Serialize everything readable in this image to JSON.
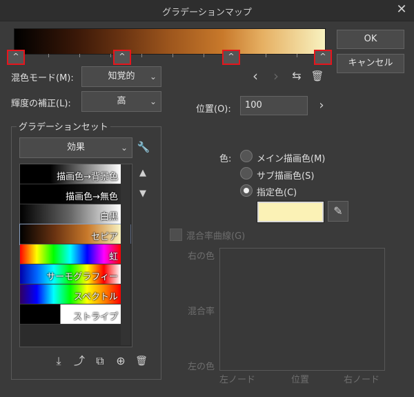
{
  "window": {
    "title": "グラデーションマップ",
    "close_glyph": "✕"
  },
  "buttons": {
    "ok": "OK",
    "cancel": "キャンセル"
  },
  "node_glyph": "^",
  "blend_mode": {
    "label": "混色モード(M):",
    "value": "知覚的"
  },
  "brightness": {
    "label": "輝度の補正(L):",
    "value": "高"
  },
  "position": {
    "label": "位置(O):",
    "value": "100"
  },
  "gradient_set": {
    "title": "グラデーションセット",
    "category": "効果",
    "items": [
      {
        "label": "描画色→背景色"
      },
      {
        "label": "描画色→無色"
      },
      {
        "label": "白黒"
      },
      {
        "label": "セピア"
      },
      {
        "label": "虹"
      },
      {
        "label": "サーモグラフィー"
      },
      {
        "label": "スペクトル"
      },
      {
        "label": "ストライプ"
      }
    ]
  },
  "color": {
    "label": "色:",
    "options": [
      "メイン描画色(M)",
      "サブ描画色(S)",
      "指定色(C)"
    ],
    "selected_index": 2,
    "specified_color": "#fbf2b6"
  },
  "mix_curve": {
    "label": "混合率曲線(G)",
    "right_color": "右の色",
    "mix_rate": "混合率",
    "left_color": "左の色",
    "left_node": "左ノード",
    "position": "位置",
    "right_node": "右ノード"
  },
  "icons": {
    "prev": "‹",
    "next": "›",
    "flip": "⇆",
    "delete": "🗑",
    "chevron": "›",
    "wrench": "🔧",
    "up": "▲",
    "down": "▼",
    "eyedropper": "✎",
    "import": "⤓",
    "export": "⤴",
    "duplicate": "⧉",
    "add": "⊕",
    "trash": "🗑",
    "select_arrow": "⌄"
  }
}
